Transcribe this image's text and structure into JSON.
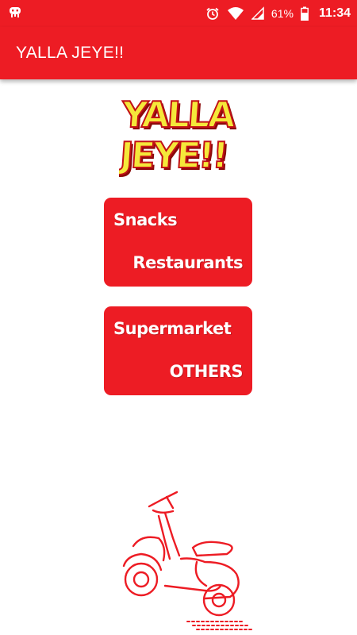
{
  "status_bar": {
    "battery_percent": "61%",
    "time": "11:34",
    "icons": [
      "debug-android-icon",
      "alarm-icon",
      "wifi-icon",
      "signal-icon",
      "battery-icon"
    ]
  },
  "app_bar": {
    "title": "YALLA JEYE!!"
  },
  "logo": {
    "line1": "YALLA",
    "line2": "JEYE!!"
  },
  "menu": {
    "card1": {
      "item_top": "Snacks",
      "item_bottom": "Restaurants"
    },
    "card2": {
      "item_top": "Supermarket",
      "item_bottom": "OTHERS"
    }
  },
  "colors": {
    "brand_red": "#ed1c24",
    "logo_yellow": "#f5e83a",
    "white": "#ffffff"
  },
  "illustration": {
    "icon": "scooter-icon"
  }
}
